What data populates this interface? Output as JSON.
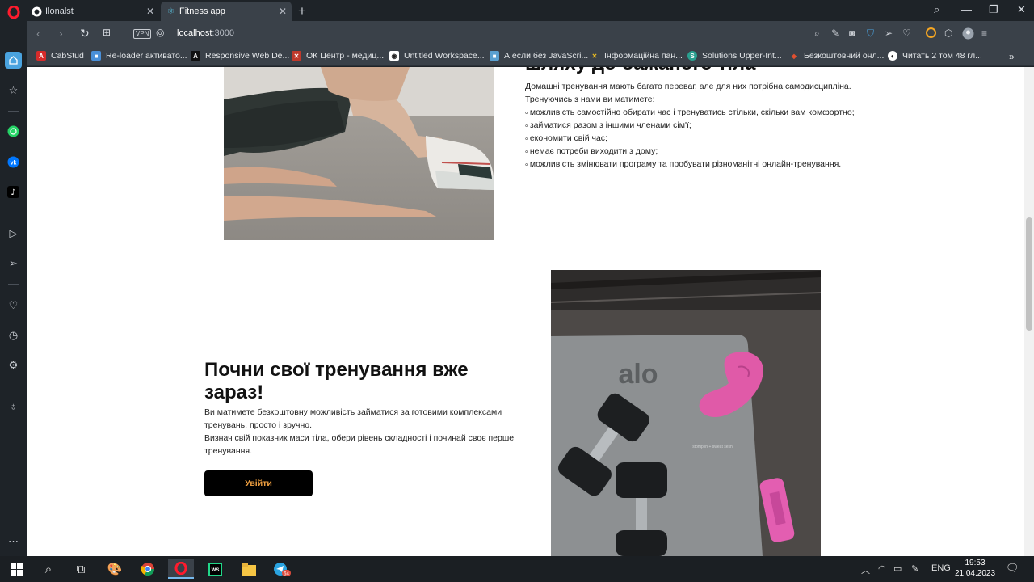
{
  "browser": {
    "tabs": [
      {
        "title": "Ilonalst",
        "icon": "github-icon"
      },
      {
        "title": "Fitness app",
        "icon": "react-icon"
      }
    ],
    "url_host": "localhost",
    "url_port": ":3000",
    "vpn_label": "VPN",
    "bookmarks": [
      {
        "label": "CabStud",
        "color": "#d62b2b",
        "glyph": "A"
      },
      {
        "label": "Re-loader активато...",
        "color": "#4a90d9",
        "glyph": "■"
      },
      {
        "label": "Responsive Web De...",
        "color": "#111111",
        "glyph": "A"
      },
      {
        "label": "ОК Центр - медиц...",
        "color": "#c0392b",
        "glyph": "✕"
      },
      {
        "label": "Untitled Workspace...",
        "color": "#ffffff",
        "glyph": "◉"
      },
      {
        "label": "А если без JavaScri...",
        "color": "#5aa0d0",
        "glyph": "■"
      },
      {
        "label": "Інформаційна пан...",
        "color": "#f0c020",
        "glyph": "✕"
      },
      {
        "label": "Solutions Upper-Int...",
        "color": "#2aa090",
        "glyph": "S"
      },
      {
        "label": "Безкоштовний онл...",
        "color": "#e05030",
        "glyph": "◆"
      },
      {
        "label": "Читать 2 том 48 гл...",
        "color": "#ffffff",
        "glyph": "◐"
      }
    ]
  },
  "page": {
    "section1": {
      "heading": "шляху до бажаного тіла",
      "intro": "Домашні тренування мають багато переваг, але для них потрібна самодисципліна.",
      "lead": "Тренуючись з нами ви матимете:",
      "items": [
        "можливість самостійно обирати час і тренуватись стільки, скільки вам комфортно;",
        "займатися разом з іншими членами сім'ї;",
        "економити свій час;",
        "немає потреби виходити з дому;",
        "можливість змінювати програму та пробувати різноманітні онлайн-тренування."
      ]
    },
    "section2": {
      "heading": "Почни свої тренування вже зараз!",
      "p1": "Ви матимете безкоштовну можливість займатися за готовими комплексами тренувань, просто і зручно.",
      "p2": "Визнач свій показник маси тіла, обери рівень складності і починай своє перше тренування.",
      "button": "Увійти",
      "mat_brand": "alo",
      "mat_tagline": "stomp in + sweat sesh"
    }
  },
  "taskbar": {
    "language": "ENG",
    "time": "19:53",
    "date": "21.04.2023",
    "telegram_badge": "64"
  }
}
